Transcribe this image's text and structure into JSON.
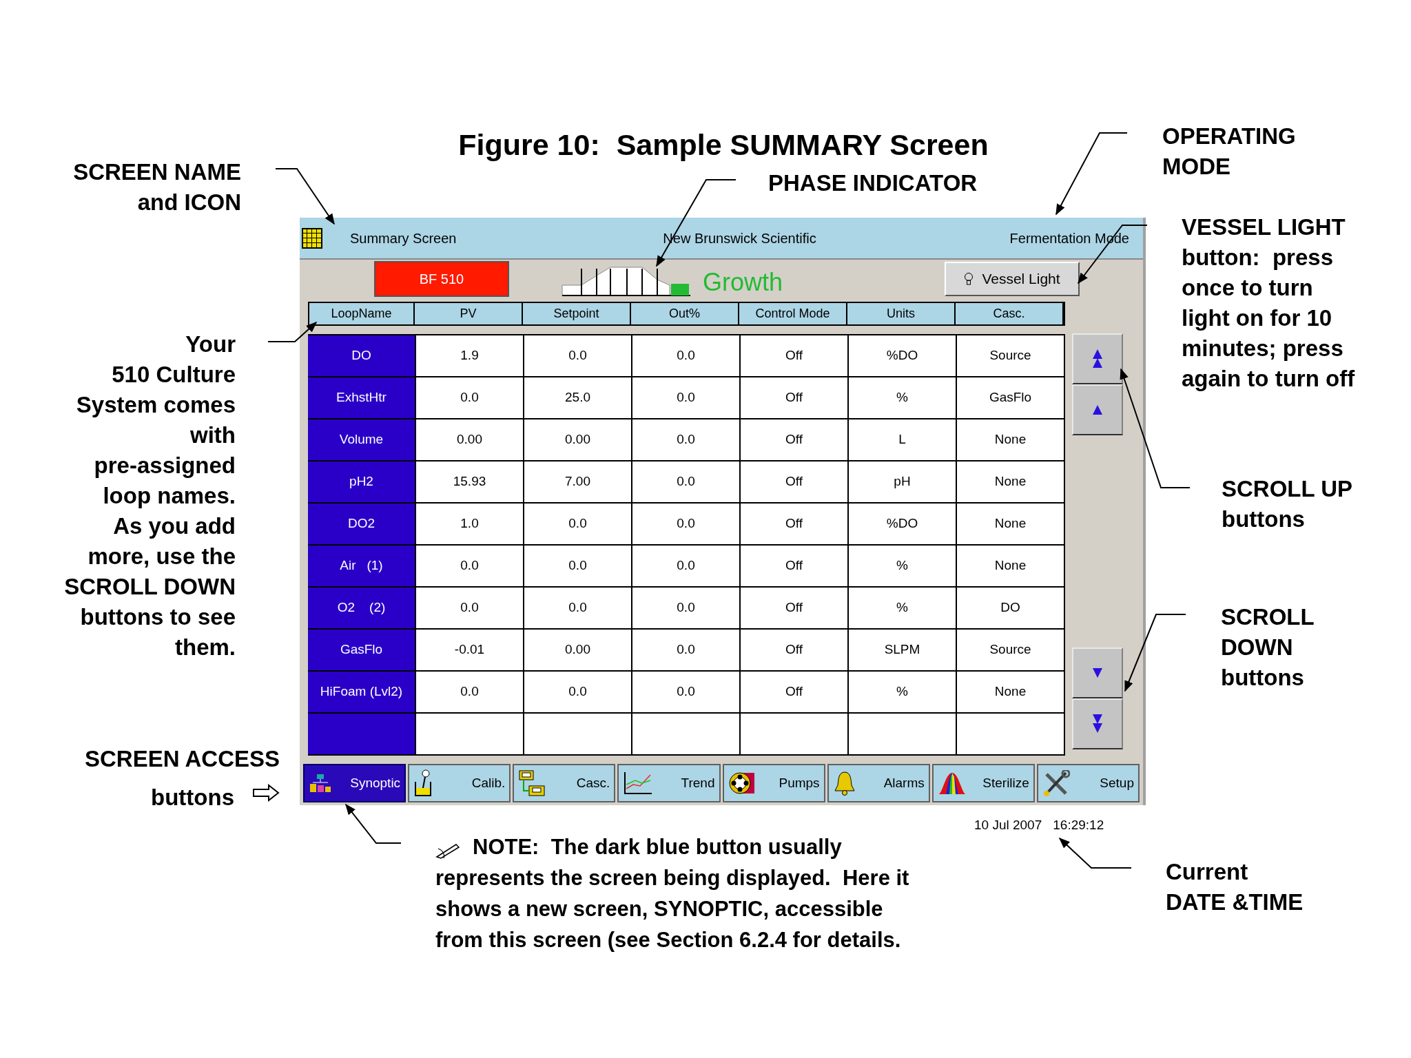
{
  "figure_title": "Figure 10:  Sample SUMMARY Screen",
  "callouts": [
    {
      "lines": [
        "SCREEN NAME",
        "and ICON"
      ]
    },
    {
      "lines": [
        "PHASE INDICATOR"
      ]
    },
    {
      "lines": [
        "OPERATING",
        "MODE"
      ]
    },
    {
      "lines": [
        "**VESSEL LIGHT**",
        "button:  press",
        "once to turn",
        "light on for 10",
        "minutes; press",
        "again to turn off"
      ]
    },
    {
      "lines": [
        "Your",
        "510 Culture",
        "System comes",
        "with",
        "pre-assigned",
        "loop names.",
        "As you add",
        "more, use the",
        "**SCROLL DOWN**",
        "buttons to see",
        "them."
      ]
    },
    {
      "lines": [
        "SCROLL UP",
        "buttons"
      ]
    },
    {
      "lines": [
        "SCROLL",
        "DOWN",
        "buttons"
      ]
    },
    {
      "lines": [
        "SCREEN ACCESS"
      ]
    },
    {
      "lines": [
        "buttons"
      ]
    },
    {
      "lines": [
        "Current",
        "DATE &TIME"
      ]
    }
  ],
  "screen": {
    "title": "Summary Screen",
    "company": "New Brunswick Scientific",
    "mode": "Fermentation Mode",
    "unit_button": "BF 510",
    "phase": "Growth",
    "vessel_light_button": "Vessel Light",
    "table": {
      "columns": [
        "LoopName",
        "PV",
        "Setpoint",
        "Out%",
        "Control Mode",
        "Units",
        "Casc."
      ],
      "rows": [
        [
          "DO",
          "1.9",
          "0.0",
          "0.0",
          "Off",
          "%DO",
          "Source"
        ],
        [
          "ExhstHtr",
          "0.0",
          "25.0",
          "0.0",
          "Off",
          "%",
          "GasFlo"
        ],
        [
          "Volume",
          "0.00",
          "0.00",
          "0.0",
          "Off",
          "L",
          "None"
        ],
        [
          "pH2",
          "15.93",
          "7.00",
          "0.0",
          "Off",
          "pH",
          "None"
        ],
        [
          "DO2",
          "1.0",
          "0.0",
          "0.0",
          "Off",
          "%DO",
          "None"
        ],
        [
          "Air   (1)",
          "0.0",
          "0.0",
          "0.0",
          "Off",
          "%",
          "None"
        ],
        [
          "O2    (2)",
          "0.0",
          "0.0",
          "0.0",
          "Off",
          "%",
          "DO"
        ],
        [
          "GasFlo",
          "-0.01",
          "0.00",
          "0.0",
          "Off",
          "SLPM",
          "Source"
        ],
        [
          "HiFoam (Lvl2)",
          "0.0",
          "0.0",
          "0.0",
          "Off",
          "%",
          "None"
        ]
      ]
    },
    "nav_buttons": [
      {
        "label": "Synoptic",
        "selected": true
      },
      {
        "label": "Calib.",
        "selected": false
      },
      {
        "label": "Casc.",
        "selected": false
      },
      {
        "label": "Trend",
        "selected": false
      },
      {
        "label": "Pumps",
        "selected": false
      },
      {
        "label": "Alarms",
        "selected": false
      },
      {
        "label": "Sterilize",
        "selected": false
      },
      {
        "label": "Setup",
        "selected": false
      }
    ]
  },
  "date": "10 Jul 2007",
  "time": "16:29:12",
  "note_lines": [
    "**NOTE:**  The dark blue button usually",
    "represents the screen being displayed.  Here it",
    "shows a new screen, **SYNOPTIC**, accessible",
    "from this screen (see Section 6.2.4 for details."
  ]
}
